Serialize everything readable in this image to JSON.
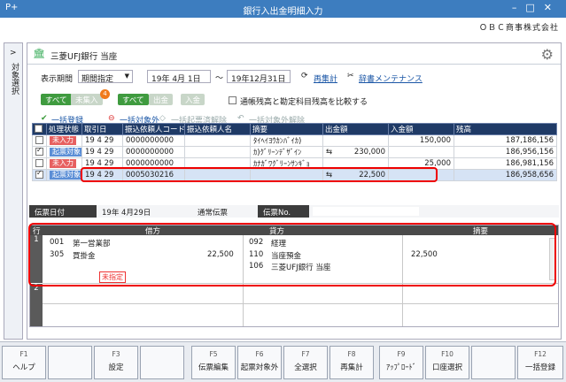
{
  "window": {
    "title": "銀行入出金明細入力",
    "company": "ＯＢＣ商事株式会社",
    "app_icon": "P+"
  },
  "side_tab": {
    "arrow": ">",
    "label": "対象選択"
  },
  "bank": {
    "name": "三菱UFJ銀行 当座"
  },
  "filter": {
    "period_label": "表示期間",
    "period_value": "期間指定",
    "date_from": "19年  4月  1日",
    "tilde": "～",
    "date_to": "19年12月31日",
    "recalc_label": "再集計",
    "dict_label": "辞書メンテナンス"
  },
  "pills": {
    "all1": "すべて",
    "unaggregated": "未集入",
    "badge": "4",
    "all2": "すべて",
    "withdrawal": "出金",
    "deposit": "入金",
    "compare_label": "通帳残高と勘定科目残高を比較する"
  },
  "actions": {
    "register_all": "一括登録",
    "exclude_all": "一括対象外",
    "cancel_registered": "一括起票済解除",
    "cancel_excluded": "一括対象外解除"
  },
  "table": {
    "headers": [
      "",
      "処理状態",
      "取引日",
      "振込依頼人コード",
      "振込依頼人名",
      "摘要",
      "出金額",
      "入金額",
      "残高"
    ],
    "rows": [
      {
        "checked": false,
        "status": "未入力",
        "date": "19   4  29",
        "code": "0000000000",
        "name": "",
        "summary": "ﾀｲﾍｲﾖｳｶﾝﾊﾞｲｶ)",
        "out": "",
        "in": "150,000",
        "balance": "187,186,156"
      },
      {
        "checked": true,
        "status": "起票対象",
        "date": "19   4  29",
        "code": "0000000000",
        "name": "",
        "summary": "ｶ)ｸﾞﾘｰﾝﾃﾞｻﾞｲﾝ",
        "out": "230,000",
        "in": "",
        "balance": "186,956,156"
      },
      {
        "checked": false,
        "status": "未入力",
        "date": "19   4  29",
        "code": "0000000000",
        "name": "",
        "summary": "ｶﾅｶﾞﾜｸﾞﾘｰﾝｻﾝｷﾞｮ",
        "out": "",
        "in": "25,000",
        "balance": "186,981,156"
      },
      {
        "checked": true,
        "status": "起票対象",
        "date": "19   4  29",
        "code": "0005030216",
        "name": "",
        "summary": "",
        "out": "22,500",
        "in": "",
        "balance": "186,958,656"
      }
    ]
  },
  "voucher": {
    "date_label": "伝票日付",
    "date_value": "19年  4月29日",
    "type_value": "通常伝票",
    "no_label": "伝票No."
  },
  "journal": {
    "headers": {
      "row": "行",
      "credit": "借方",
      "debit": "貸方",
      "memo": "摘要"
    },
    "row1": {
      "num": "1",
      "dr_dept_code": "001",
      "dr_dept": "第一営業部",
      "dr_acct_code": "305",
      "dr_acct": "買掛金",
      "dr_amount": "22,500",
      "cr_dept_code": "092",
      "cr_dept": "経理",
      "cr_acct_code": "110",
      "cr_acct": "当座預金",
      "cr_amount": "22,500",
      "cr_sub_code": "106",
      "cr_sub": "三菱UFJ銀行 当座",
      "unassigned": "未指定"
    },
    "row2": {
      "num": "2"
    }
  },
  "fkeys": [
    {
      "key": "F1",
      "label": "ヘルプ"
    },
    {
      "key": "",
      "label": ""
    },
    {
      "key": "F3",
      "label": "設定"
    },
    {
      "key": "",
      "label": ""
    },
    {
      "key": "F5",
      "label": "伝票編集"
    },
    {
      "key": "F6",
      "label": "起票対象外"
    },
    {
      "key": "F7",
      "label": "全選択"
    },
    {
      "key": "F8",
      "label": "再集計"
    },
    {
      "key": "F9",
      "label": "ｱｯﾌﾟﾛｰﾄﾞ"
    },
    {
      "key": "F10",
      "label": "口座選択"
    },
    {
      "key": "",
      "label": ""
    },
    {
      "key": "F12",
      "label": "一括登録"
    }
  ]
}
